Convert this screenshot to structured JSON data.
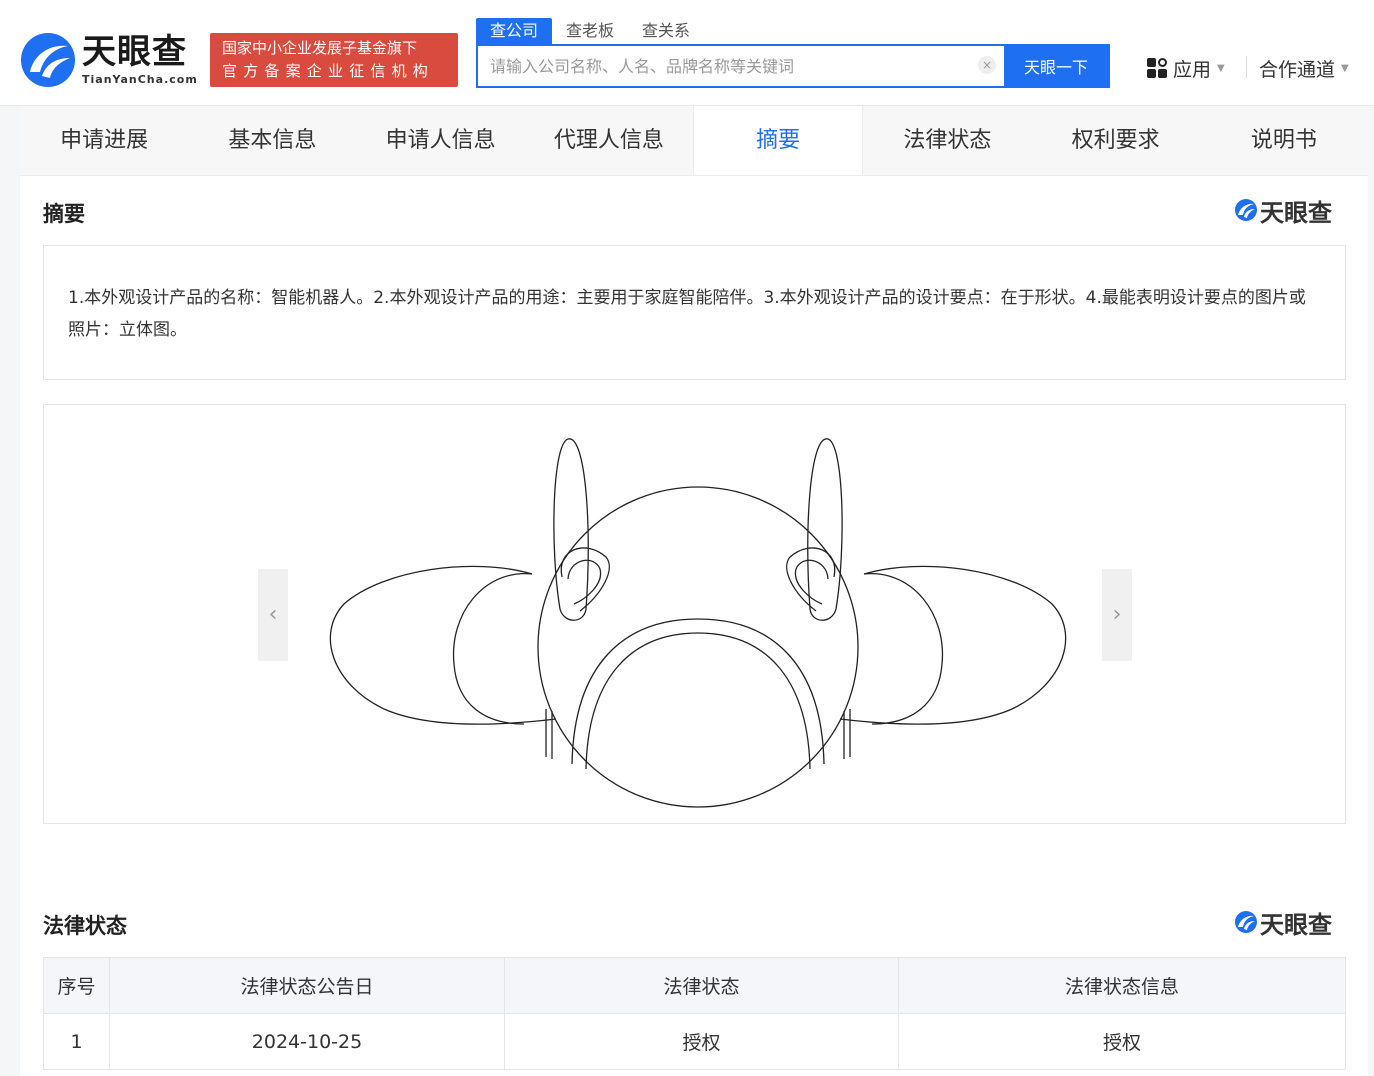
{
  "brand": {
    "name": "天眼查",
    "domain": "TianYanCha.com",
    "badge_line1": "国家中小企业发展子基金旗下",
    "badge_line2": "官方备案企业征信机构"
  },
  "search": {
    "tabs": [
      "查公司",
      "查老板",
      "查关系"
    ],
    "active_tab": 0,
    "placeholder": "请输入公司名称、人名、品牌名称等关键词",
    "clear_label": "×",
    "button": "天眼一下"
  },
  "header_menu": {
    "apps": "应用",
    "partner": "合作通道"
  },
  "tabs": [
    "申请进展",
    "基本信息",
    "申请人信息",
    "代理人信息",
    "摘要",
    "法律状态",
    "权利要求",
    "说明书"
  ],
  "active_tab_index": 4,
  "abstract": {
    "title": "摘要",
    "watermark": "天眼查",
    "text": "1.本外观设计产品的名称：智能机器人。2.本外观设计产品的用途：主要用于家庭智能陪伴。3.本外观设计产品的设计要点：在于形状。4.最能表明设计要点的图片或照片：立体图。",
    "prev": "‹",
    "next": "›"
  },
  "legal": {
    "title": "法律状态",
    "watermark": "天眼查",
    "columns": [
      "序号",
      "法律状态公告日",
      "法律状态",
      "法律状态信息"
    ],
    "rows": [
      {
        "index": "1",
        "date": "2024-10-25",
        "status": "授权",
        "info": "授权"
      }
    ]
  },
  "colors": {
    "accent": "#1e6ff2",
    "badge": "#d94b3f"
  }
}
